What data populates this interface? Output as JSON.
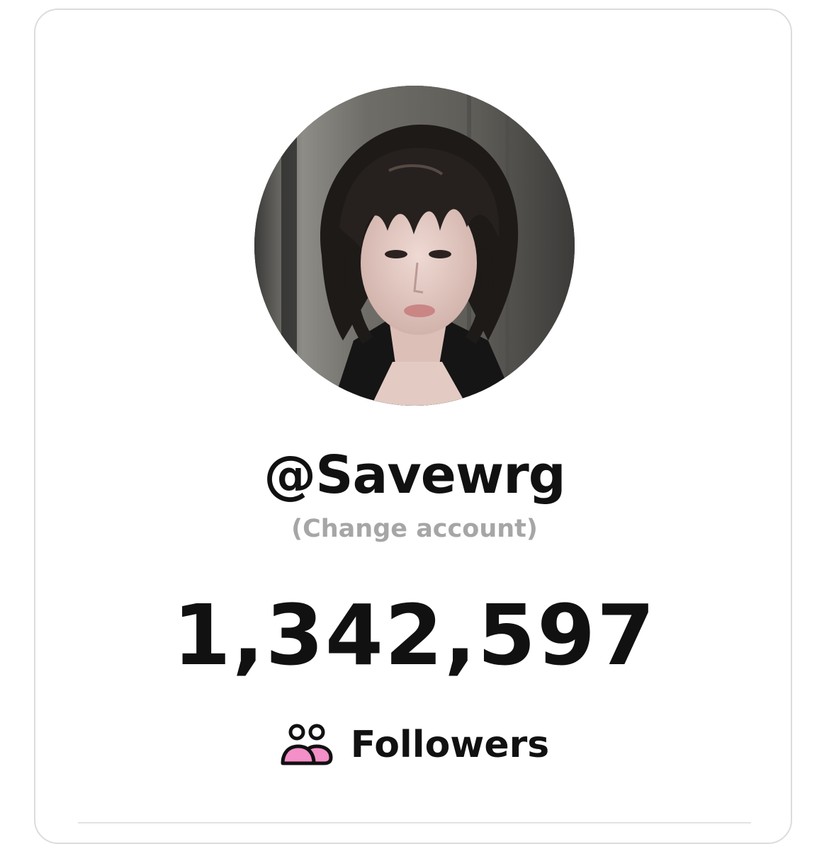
{
  "profile": {
    "username": "@Savewrg",
    "change_account_label": "(Change account)",
    "avatar_icon": "profile-photo"
  },
  "stats": {
    "followers_count": "1,342,597",
    "followers_label": "Followers",
    "followers_icon": "people-icon",
    "icon_accent_color": "#f48fc8"
  }
}
